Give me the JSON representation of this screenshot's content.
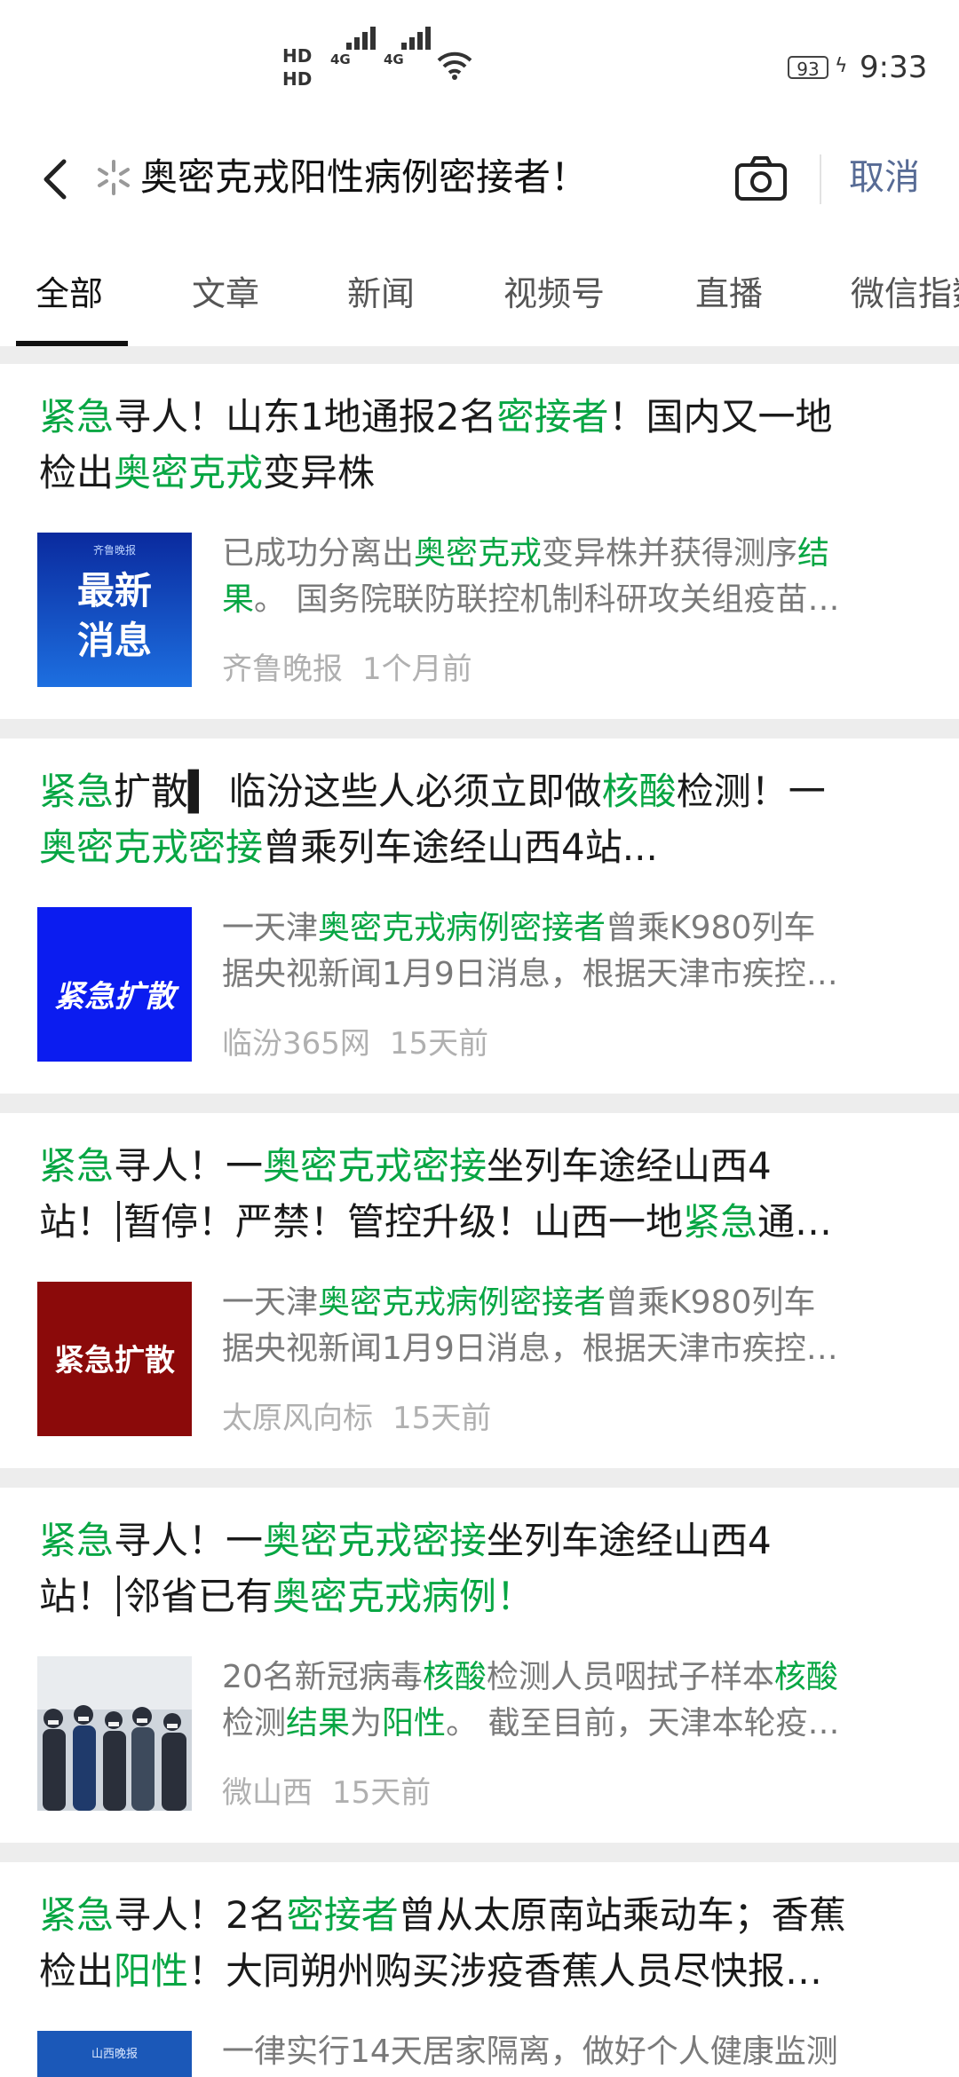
{
  "status_bar": {
    "hd1": "HD",
    "hd2": "HD",
    "net1": "4G",
    "net2": "4G",
    "battery": "93",
    "time": "9:33"
  },
  "search": {
    "query": "奥密克戎阳性病例密接者！",
    "cancel": "取消"
  },
  "tabs": [
    "全部",
    "文章",
    "新闻",
    "视频号",
    "直播",
    "微信指数"
  ],
  "results": [
    {
      "title_line1": [
        {
          "t": "紧急",
          "h": true
        },
        {
          "t": "寻人！山东1地通报2名",
          "h": false
        },
        {
          "t": "密接者",
          "h": true
        },
        {
          "t": "！国内又一地",
          "h": false
        }
      ],
      "title_line2": [
        {
          "t": "检出",
          "h": false
        },
        {
          "t": "奥密克戎",
          "h": true
        },
        {
          "t": "变异株",
          "h": false
        }
      ],
      "thumb_text1": "最新",
      "thumb_text2": "消息",
      "thumb_tag": "齐鲁晚报",
      "snippet_line1": [
        {
          "t": "已成功分离出",
          "h": false
        },
        {
          "t": "奥密克戎",
          "h": true
        },
        {
          "t": "变异株并获得测序",
          "h": false
        },
        {
          "t": "结",
          "h": true
        }
      ],
      "snippet_line2": [
        {
          "t": "果",
          "h": true
        },
        {
          "t": "。 国务院联防联控机制科研攻关组疫苗…",
          "h": false
        }
      ],
      "source": "齐鲁晚报",
      "time": "1个月前"
    },
    {
      "title_line1": [
        {
          "t": "紧急",
          "h": true
        },
        {
          "t": "扩散▍ 临汾这些人必须立即做",
          "h": false
        },
        {
          "t": "核酸",
          "h": true
        },
        {
          "t": "检测！一",
          "h": false
        }
      ],
      "title_line2": [
        {
          "t": "奥密克戎密接",
          "h": true
        },
        {
          "t": "曾乘列车途经山西4站...",
          "h": false
        }
      ],
      "thumb_text1": "紧急扩散",
      "snippet_line1": [
        {
          "t": "一天津",
          "h": false
        },
        {
          "t": "奥密克戎病例密接者",
          "h": true
        },
        {
          "t": "曾乘K980列车",
          "h": false
        }
      ],
      "snippet_line2": [
        {
          "t": "据央视新闻1月9日消息，根据天津市疾控…",
          "h": false
        }
      ],
      "source": "临汾365网",
      "time": "15天前"
    },
    {
      "title_line1": [
        {
          "t": "紧急",
          "h": true
        },
        {
          "t": "寻人！一",
          "h": false
        },
        {
          "t": "奥密克戎密接",
          "h": true
        },
        {
          "t": "坐列车途经山西4",
          "h": false
        }
      ],
      "title_line2": [
        {
          "t": "站！",
          "h": false
        },
        {
          "t": "|",
          "h": false,
          "cursor": true
        },
        {
          "t": "暂停！严禁！管控升级！山西一地",
          "h": false
        },
        {
          "t": "紧急",
          "h": true
        },
        {
          "t": "通…",
          "h": false
        }
      ],
      "thumb_text1": "紧急扩散",
      "snippet_line1": [
        {
          "t": "一天津",
          "h": false
        },
        {
          "t": "奥密克戎病例密接者",
          "h": true
        },
        {
          "t": "曾乘K980列车",
          "h": false
        }
      ],
      "snippet_line2": [
        {
          "t": "据央视新闻1月9日消息，根据天津市疾控…",
          "h": false
        }
      ],
      "source": "太原风向标",
      "time": "15天前"
    },
    {
      "title_line1": [
        {
          "t": "紧急",
          "h": true
        },
        {
          "t": "寻人！一",
          "h": false
        },
        {
          "t": "奥密克戎密接",
          "h": true
        },
        {
          "t": "坐列车途经山西4",
          "h": false
        }
      ],
      "title_line2": [
        {
          "t": "站！",
          "h": false
        },
        {
          "t": "|",
          "h": false,
          "cursor": true
        },
        {
          "t": "邻省已有",
          "h": false
        },
        {
          "t": "奥密克戎病例！",
          "h": true
        }
      ],
      "snippet_line1": [
        {
          "t": "20名新冠病毒",
          "h": false
        },
        {
          "t": "核酸",
          "h": true
        },
        {
          "t": "检测人员咽拭子样本",
          "h": false
        },
        {
          "t": "核酸",
          "h": true
        }
      ],
      "snippet_line2": [
        {
          "t": "检测",
          "h": false
        },
        {
          "t": "结果",
          "h": true
        },
        {
          "t": "为",
          "h": false
        },
        {
          "t": "阳性",
          "h": true
        },
        {
          "t": "。 截至目前，天津本轮疫…",
          "h": false
        }
      ],
      "source": "微山西",
      "time": "15天前"
    },
    {
      "title_line1": [
        {
          "t": "紧急",
          "h": true
        },
        {
          "t": "寻人！2名",
          "h": false
        },
        {
          "t": "密接者",
          "h": true
        },
        {
          "t": "曾从太原南站乘动车；香蕉",
          "h": false
        }
      ],
      "title_line2": [
        {
          "t": "检出",
          "h": false
        },
        {
          "t": "阳性",
          "h": true
        },
        {
          "t": "！大同朔州购买涉疫香蕉人员尽快报…",
          "h": false
        }
      ],
      "thumb_tag": "山西晚报",
      "snippet_line1": [
        {
          "t": "一律实行14天居家隔离，做好个人健康监测",
          "h": false
        }
      ]
    }
  ],
  "colors": {
    "highlight": "#07a643",
    "link": "#576b95",
    "card_bg": "#ffffff",
    "page_bg": "#ededed"
  }
}
